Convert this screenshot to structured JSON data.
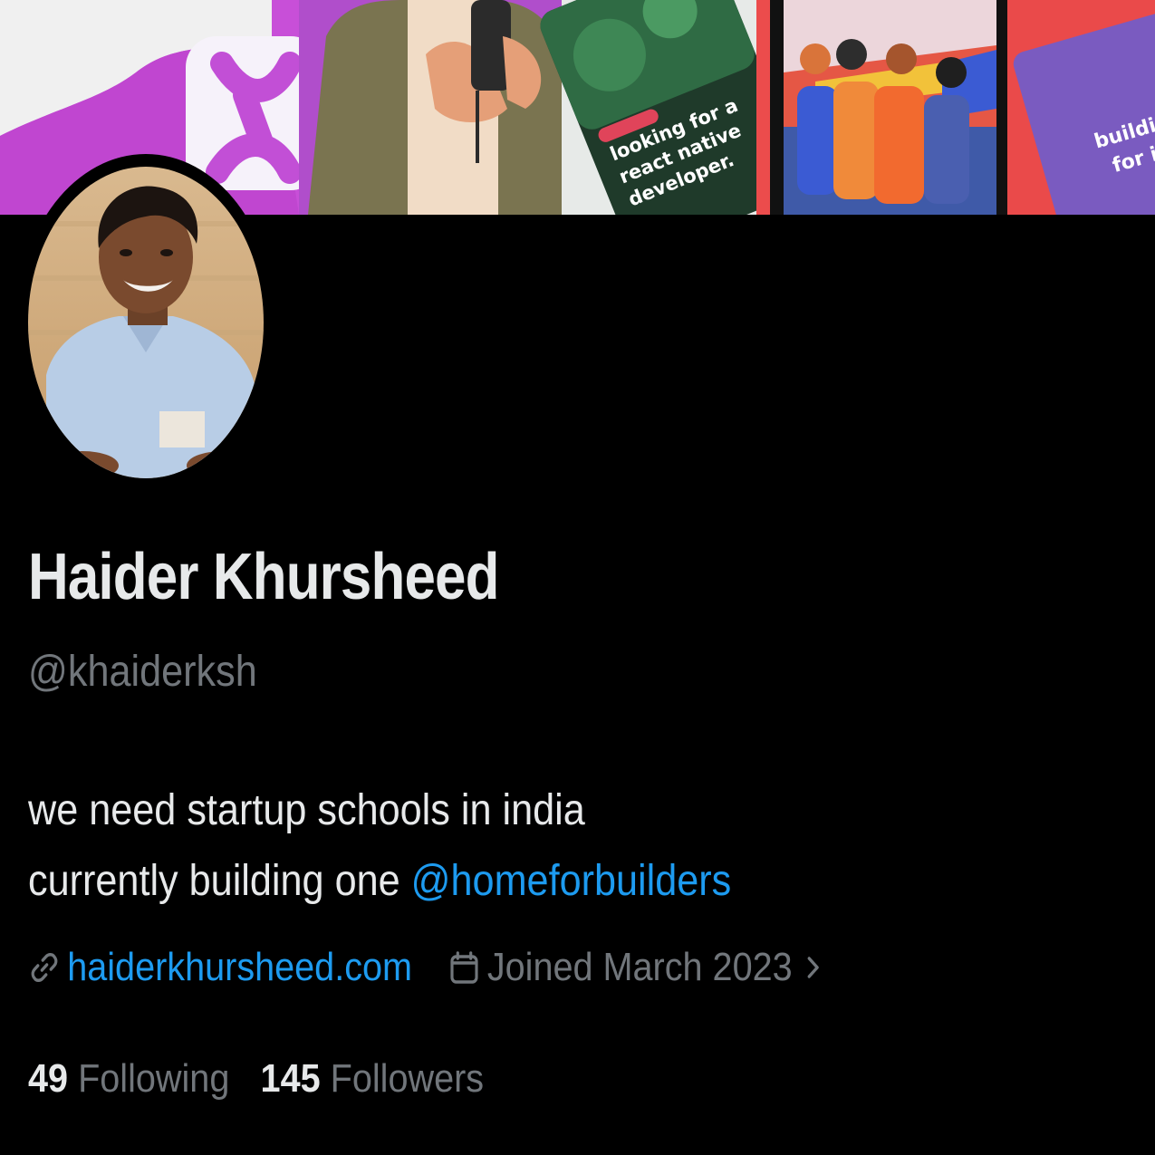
{
  "banner": {
    "slides": [
      {
        "text_lines": [
          "looking for a",
          "react native",
          "developer."
        ]
      },
      {
        "text_lines": [
          "buildin",
          "for in"
        ]
      }
    ]
  },
  "profile": {
    "display_name": "Haider Khursheed",
    "handle": "@khaiderksh",
    "bio": {
      "line1": "we need startup schools in india",
      "line2_prefix": "currently building one ",
      "line2_mention": "@homeforbuilders"
    },
    "website": "haiderkhursheed.com",
    "joined": "Joined March 2023",
    "following_count": "49",
    "following_label": "Following",
    "followers_count": "145",
    "followers_label": "Followers"
  },
  "icons": {
    "website": "link-icon",
    "joined": "calendar-icon",
    "expand": "chevron-right-icon"
  },
  "colors": {
    "background": "#000000",
    "text_primary": "#e7e9ea",
    "text_secondary": "#71767b",
    "link": "#1d9bf0"
  }
}
